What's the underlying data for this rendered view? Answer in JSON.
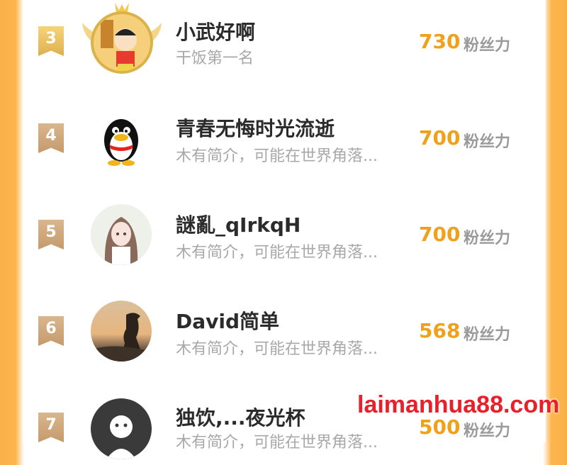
{
  "rows": [
    {
      "rank": "3",
      "name": "小武好啊",
      "bio": "干饭第一名",
      "score": "730",
      "unit": "粉丝力",
      "avatar": "cartoon-boy-avatar"
    },
    {
      "rank": "4",
      "name": "青春无悔时光流逝",
      "bio": "木有简介，可能在世界角落...",
      "score": "700",
      "unit": "粉丝力",
      "avatar": "penguin-avatar"
    },
    {
      "rank": "5",
      "name": "謎亂_qIrkqH",
      "bio": "木有简介，可能在世界角落...",
      "score": "700",
      "unit": "粉丝力",
      "avatar": "anime-girl-avatar"
    },
    {
      "rank": "6",
      "name": "David简单",
      "bio": "木有简介，可能在世界角落...",
      "score": "568",
      "unit": "粉丝力",
      "avatar": "sunset-person-avatar"
    },
    {
      "rank": "7",
      "name": "独饮,...夜光杯",
      "bio": "木有简介，可能在世界角落...",
      "score": "500",
      "unit": "粉丝力",
      "avatar": "default-user-avatar"
    }
  ],
  "colors": {
    "accent": "#f0a11c",
    "border": "#fdb54d"
  },
  "watermark": "laimanhua88.com"
}
